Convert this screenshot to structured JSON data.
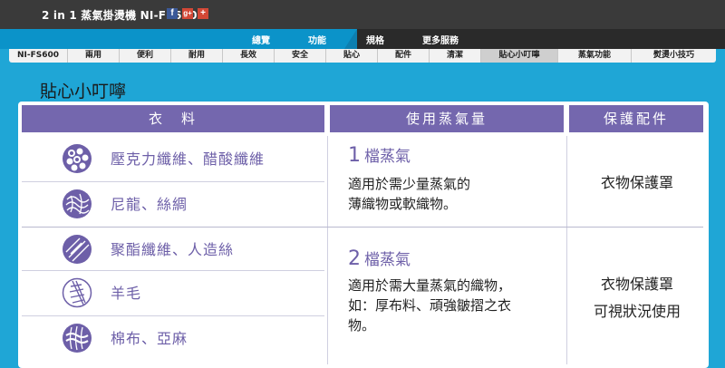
{
  "top": {
    "title": "2 in 1 蒸氣掛燙機 NI-FS600",
    "icons": [
      "facebook-icon",
      "google-plus-icon",
      "plus-icon"
    ]
  },
  "mainnav": {
    "items": [
      "總覽",
      "功能",
      "規格",
      "更多服務"
    ]
  },
  "subnav": {
    "items": [
      "NI-FS600",
      "兩用",
      "便利",
      "耐用",
      "長效",
      "安全",
      "貼心",
      "配件",
      "清潔",
      "貼心小叮嚀",
      "蒸氣功能",
      "熨燙小技巧"
    ],
    "selected": "貼心小叮嚀"
  },
  "section": {
    "title": "貼心小叮嚀"
  },
  "table": {
    "headers": {
      "fabric": "衣　料",
      "steam": "使用蒸氣量",
      "accessory": "保護配件"
    },
    "fabrics": [
      {
        "label": "壓克力纖維、醋酸纖維",
        "icon": "acrylic-fiber-icon"
      },
      {
        "label": "尼龍、絲綢",
        "icon": "nylon-silk-icon"
      },
      {
        "label": "聚酯纖維、人造絲",
        "icon": "polyester-icon"
      },
      {
        "label": "羊毛",
        "icon": "wool-icon"
      },
      {
        "label": "棉布、亞麻",
        "icon": "cotton-linen-icon"
      }
    ],
    "steam": [
      {
        "num": "1",
        "level": "檔蒸氣",
        "desc1": "適用於需少量蒸氣的",
        "desc2": "薄織物或軟織物。"
      },
      {
        "num": "2",
        "level": "檔蒸氣",
        "desc1": "適用於需大量蒸氣的織物，",
        "desc2": "如：厚布料、頑強皺摺之衣",
        "desc3": "物。"
      }
    ],
    "accessory": [
      {
        "line1": "衣物保護罩"
      },
      {
        "line1": "衣物保護罩",
        "line2": "可視狀況使用"
      }
    ]
  },
  "colors": {
    "accent": "#7467ae",
    "text_purple": "#6d5fa8",
    "background": "#1fa6d6"
  }
}
